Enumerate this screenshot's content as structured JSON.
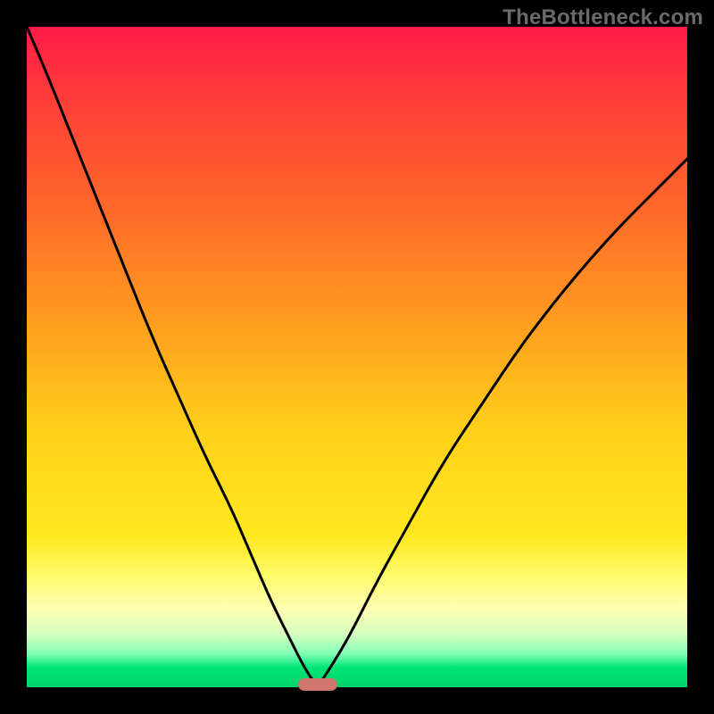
{
  "watermark": {
    "text": "TheBottleneck.com"
  },
  "chart_data": {
    "type": "line",
    "title": "",
    "xlabel": "",
    "ylabel": "",
    "xlim": [
      0,
      1
    ],
    "ylim": [
      0,
      1
    ],
    "grid": false,
    "legend": false,
    "notes": "No axis ticks or labels are shown. x and y are normalized to the plot area. The curve forms a V shape reaching y≈0 near x≈0.44 with a small flat segment at the bottom, then rising again to the right. The y-axis appears to run top-to-bottom (y=1 at top, y=0 at bottom) as a bottleneck-percentage style chart with a green band near the bottom.",
    "background_gradient_top_to_bottom": [
      "#ff1a47",
      "#ff6a2a",
      "#ffd21a",
      "#fffeb0",
      "#00e676"
    ],
    "optimum_marker": {
      "x": 0.44,
      "y": 0.0,
      "color": "#d0766f",
      "shape": "rounded-bar"
    },
    "series": [
      {
        "name": "bottleneck-curve",
        "color": "#000000",
        "x": [
          0.0,
          0.03,
          0.07,
          0.11,
          0.15,
          0.19,
          0.23,
          0.27,
          0.31,
          0.34,
          0.37,
          0.4,
          0.42,
          0.44,
          0.46,
          0.49,
          0.53,
          0.58,
          0.63,
          0.69,
          0.75,
          0.82,
          0.89,
          0.96,
          1.0
        ],
        "y": [
          1.0,
          0.93,
          0.83,
          0.73,
          0.63,
          0.53,
          0.44,
          0.35,
          0.27,
          0.2,
          0.13,
          0.07,
          0.03,
          0.0,
          0.03,
          0.08,
          0.16,
          0.25,
          0.34,
          0.43,
          0.52,
          0.61,
          0.69,
          0.76,
          0.8
        ]
      }
    ]
  }
}
